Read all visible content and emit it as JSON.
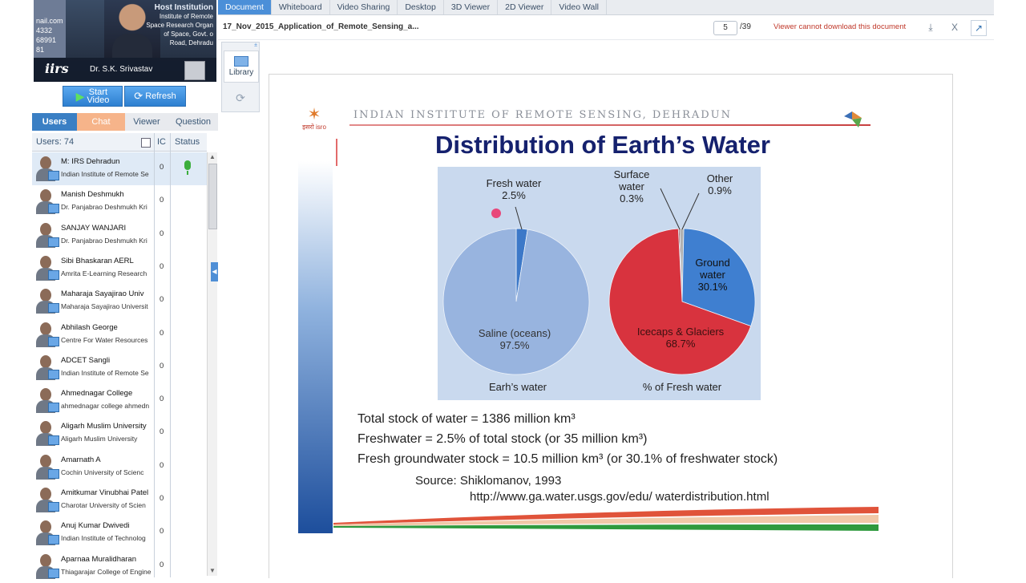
{
  "video": {
    "left_text": [
      "nail.com",
      "4332",
      "68991",
      "81"
    ],
    "inst_title": "Host Institution",
    "inst_lines": [
      "Institute of Remote",
      "Space Research Organ",
      "of Space, Govt. o",
      "Road, Dehradu"
    ],
    "logo": "iirs",
    "presenter": "Dr. S.K. Srivastav"
  },
  "buttons": {
    "start_line1": "Start",
    "start_line2": "Video",
    "refresh": "Refresh"
  },
  "side_tabs": [
    "Users",
    "Chat",
    "Viewer",
    "Question"
  ],
  "list_header": {
    "count": "Users: 74",
    "ic": "IC",
    "status": "Status"
  },
  "users": [
    {
      "name": "M: IRS Dehradun",
      "org": "Indian Institute of Remote Se",
      "ic": "0"
    },
    {
      "name": "Manish Deshmukh",
      "org": "Dr. Panjabrao Deshmukh Kri",
      "ic": "0"
    },
    {
      "name": "SANJAY WANJARI",
      "org": "Dr. Panjabrao Deshmukh Kri",
      "ic": "0"
    },
    {
      "name": "Sibi Bhaskaran AERL",
      "org": "Amrita E-Learning Research",
      "ic": "0"
    },
    {
      "name": "Maharaja Sayajirao Univ",
      "org": "Maharaja Sayajirao Universit",
      "ic": "0"
    },
    {
      "name": "Abhilash George",
      "org": "Centre For Water Resources",
      "ic": "0"
    },
    {
      "name": "ADCET Sangli",
      "org": "Indian Institute of Remote Se",
      "ic": "0"
    },
    {
      "name": "Ahmednagar College",
      "org": "ahmednagar college ahmedn",
      "ic": "0"
    },
    {
      "name": "Aligarh Muslim University",
      "org": "Aligarh Muslim University",
      "ic": "0"
    },
    {
      "name": "Amarnath A",
      "org": "Cochin University of Scienc",
      "ic": "0"
    },
    {
      "name": "Amitkumar Vinubhai Patel",
      "org": "Charotar University of Scien",
      "ic": "0"
    },
    {
      "name": "Anuj Kumar Dwivedi",
      "org": "Indian Institute of Technolog",
      "ic": "0"
    },
    {
      "name": "Aparnaa Muralidharan",
      "org": "Thiagarajar College of Engine",
      "ic": "0"
    }
  ],
  "top_tabs": [
    "Document",
    "Whiteboard",
    "Video Sharing",
    "Desktop",
    "3D Viewer",
    "2D Viewer",
    "Video Wall"
  ],
  "docbar": {
    "title": "17_Nov_2015_Application_of_Remote_Sensing_a...",
    "page": "5",
    "total": "/39",
    "notice": "Viewer cannot download this document",
    "close": "X"
  },
  "library": {
    "label": "Library",
    "pin": "±"
  },
  "slide": {
    "inst": "INDIAN INSTITUTE OF REMOTE SENSING, DEHRADUN",
    "isro": "इसरो isro",
    "title": "Distribution of Earth’s Water",
    "stats": [
      "Total stock of water = 1386 million km³",
      "Freshwater = 2.5% of total stock (or 35 million km³)",
      "Fresh groundwater stock = 10.5 million km³  (or 30.1% of freshwater stock)"
    ],
    "source_line": "Source:  Shiklomanov, 1993",
    "source_url": "http://www.ga.water.usgs.gov/edu/ waterdistribution.html"
  },
  "chart_data": [
    {
      "type": "pie",
      "title": "Earh’s water",
      "categories": [
        "Fresh water",
        "Saline (oceans)"
      ],
      "values": [
        2.5,
        97.5
      ],
      "labels": [
        "Fresh water 2.5%",
        "Saline (oceans) 97.5%"
      ],
      "colors": [
        "#3c78c8",
        "#98b4df"
      ]
    },
    {
      "type": "pie",
      "title": "% of Fresh water",
      "categories": [
        "Surface water",
        "Other",
        "Ground water",
        "Icecaps & Glaciers"
      ],
      "values": [
        0.3,
        0.9,
        30.1,
        68.7
      ],
      "labels": [
        "Surface water 0.3%",
        "Other 0.9%",
        "Ground water 30.1%",
        "Icecaps & Glaciers 68.7%"
      ],
      "colors": [
        "#7a3a3a",
        "#b0b0b0",
        "#3f7fd0",
        "#d8333e"
      ]
    }
  ]
}
